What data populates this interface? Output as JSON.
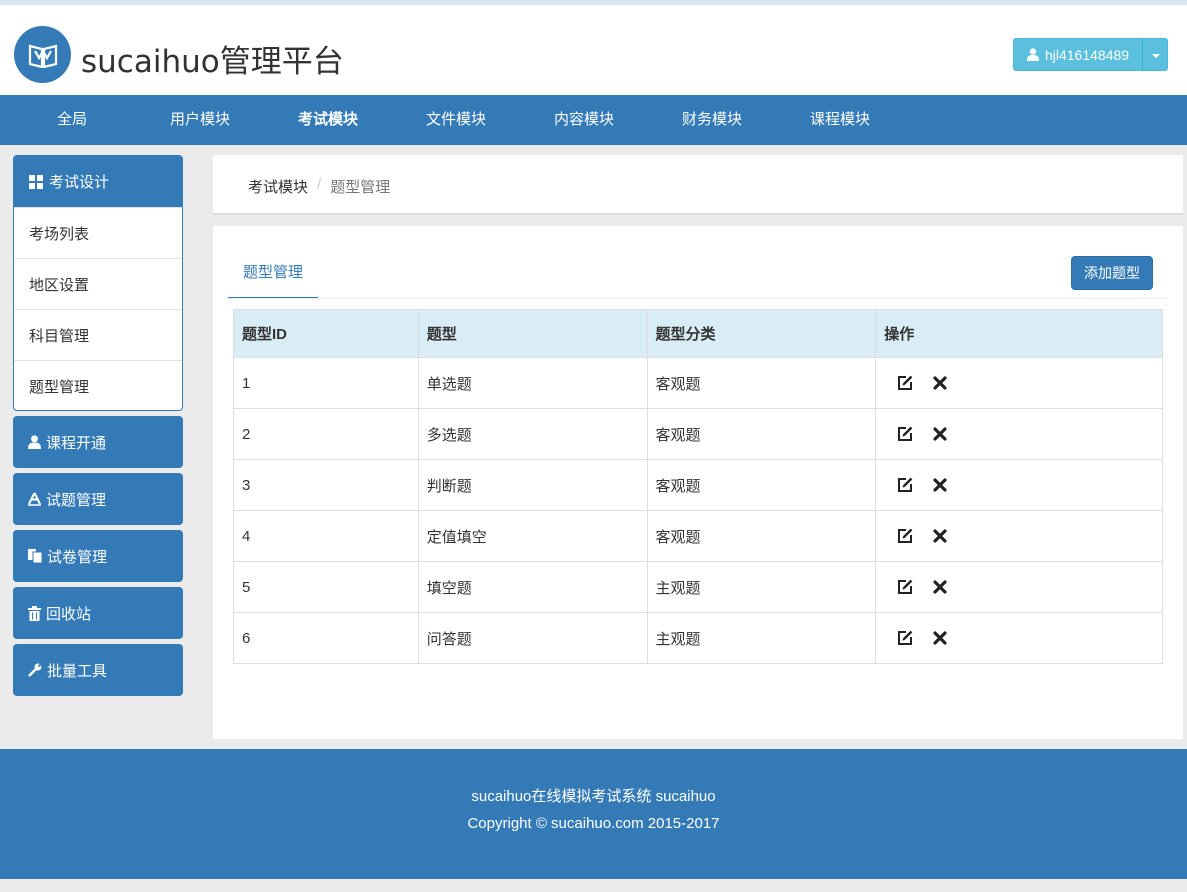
{
  "header": {
    "brand": "sucaihuo管理平台",
    "user": "hjl416148489"
  },
  "nav": [
    "全局",
    "用户模块",
    "考试模块",
    "文件模块",
    "内容模块",
    "财务模块",
    "课程模块"
  ],
  "sidebar": {
    "head": "考试设计",
    "items": [
      "考场列表",
      "地区设置",
      "科目管理",
      "题型管理"
    ],
    "buttons": [
      "课程开通",
      "试题管理",
      "试卷管理",
      "回收站",
      "批量工具"
    ]
  },
  "breadcrumb": {
    "parent": "考试模块",
    "current": "题型管理"
  },
  "tab": "题型管理",
  "add_button": "添加题型",
  "table": {
    "headers": [
      "题型ID",
      "题型",
      "题型分类",
      "操作"
    ],
    "rows": [
      {
        "id": "1",
        "name": "单选题",
        "category": "客观题"
      },
      {
        "id": "2",
        "name": "多选题",
        "category": "客观题"
      },
      {
        "id": "3",
        "name": "判断题",
        "category": "客观题"
      },
      {
        "id": "4",
        "name": "定值填空",
        "category": "客观题"
      },
      {
        "id": "5",
        "name": "填空题",
        "category": "主观题"
      },
      {
        "id": "6",
        "name": "问答题",
        "category": "主观题"
      }
    ]
  },
  "footer": {
    "line1": "sucaihuo在线模拟考试系统 sucaihuo",
    "line2": "Copyright © sucaihuo.com 2015-2017"
  },
  "colors": {
    "primary": "#337ab7",
    "info": "#5bc0de",
    "table_head": "#d9edf7"
  }
}
